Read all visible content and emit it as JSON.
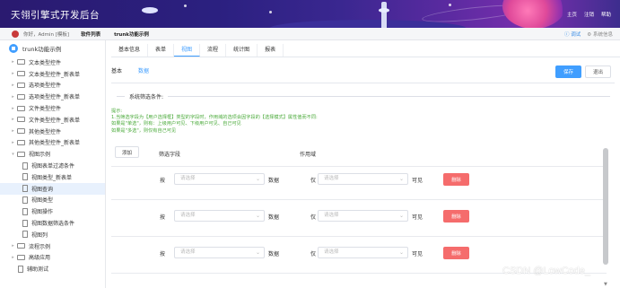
{
  "header": {
    "title": "天翎引擎式开发后台",
    "links": [
      "主页",
      "注销",
      "帮助"
    ]
  },
  "subbar": {
    "hello": "你好，Admin [模板]",
    "crumbs": [
      "软件列表",
      "trunk功能示例"
    ],
    "debug": "调试",
    "settings": "系统信息",
    "debug_icon": "info-circle-icon",
    "settings_icon": "gear-icon"
  },
  "sidebar": {
    "root": "trunk功能示例",
    "items": [
      {
        "label": "文本类型控件",
        "type": "folder",
        "level": 1
      },
      {
        "label": "文本类型控件_新表单",
        "type": "folder",
        "level": 1
      },
      {
        "label": "选项类型控件",
        "type": "folder",
        "level": 1
      },
      {
        "label": "选项类型控件_新表单",
        "type": "folder",
        "level": 1
      },
      {
        "label": "文件类型控件",
        "type": "folder",
        "level": 1
      },
      {
        "label": "文件类型控件_新表单",
        "type": "folder",
        "level": 1
      },
      {
        "label": "其他类型控件",
        "type": "folder",
        "level": 1
      },
      {
        "label": "其他类型控件_新表单",
        "type": "folder",
        "level": 1
      },
      {
        "label": "视图示例",
        "type": "folder",
        "level": 1,
        "expanded": true
      },
      {
        "label": "视图表单过滤条件",
        "type": "file",
        "level": 2
      },
      {
        "label": "视图类型_新表单",
        "type": "file",
        "level": 2
      },
      {
        "label": "视图查询",
        "type": "file",
        "level": 2,
        "selected": true
      },
      {
        "label": "视图类型",
        "type": "file",
        "level": 2
      },
      {
        "label": "视图操作",
        "type": "file",
        "level": 2
      },
      {
        "label": "视图数据筛选条件",
        "type": "file",
        "level": 2
      },
      {
        "label": "视图列",
        "type": "file",
        "level": 2
      },
      {
        "label": "流程示例",
        "type": "folder",
        "level": 1
      },
      {
        "label": "高级应用",
        "type": "folder",
        "level": 1
      },
      {
        "label": "辅助测试",
        "type": "file",
        "level": 1
      }
    ]
  },
  "main": {
    "tabs": [
      "基本信息",
      "表单",
      "视图",
      "流程",
      "统计图",
      "报表"
    ],
    "active_tab": "视图",
    "subtabs": [
      "基本",
      "数据"
    ],
    "active_subtab": "数据",
    "save_label": "保存",
    "exit_label": "退出",
    "fieldset_legend": "系统筛选条件:",
    "tips": [
      "提示:",
      "1.当筛选字段为【用户选择框】类型的字段时，作用域的选项会因字段的【选择模式】属性值而不同:",
      "如果是\"单选\"，则有：上级用户可见、下级用户可见、自己可见",
      "如果是\"多选\"，则仅有自己可见"
    ],
    "add_label": "添加",
    "col_field": "筛选字段",
    "col_scope": "作用域",
    "rows": [
      {
        "by": "按",
        "field_placeholder": "请选择",
        "data": "数据",
        "only": "仅",
        "scope_placeholder": "请选择",
        "visible": "可见",
        "delete": "删除"
      },
      {
        "by": "按",
        "field_placeholder": "请选择",
        "data": "数据",
        "only": "仅",
        "scope_placeholder": "请选择",
        "visible": "可见",
        "delete": "删除"
      },
      {
        "by": "按",
        "field_placeholder": "请选择",
        "data": "数据",
        "only": "仅",
        "scope_placeholder": "请选择",
        "visible": "可见",
        "delete": "删除"
      }
    ]
  },
  "watermark": "CSDN @LowCode_",
  "colors": {
    "accent": "#409eff",
    "danger": "#f56c6c",
    "tip_text": "#4aaa3a",
    "header_bg": "#2b2080"
  }
}
